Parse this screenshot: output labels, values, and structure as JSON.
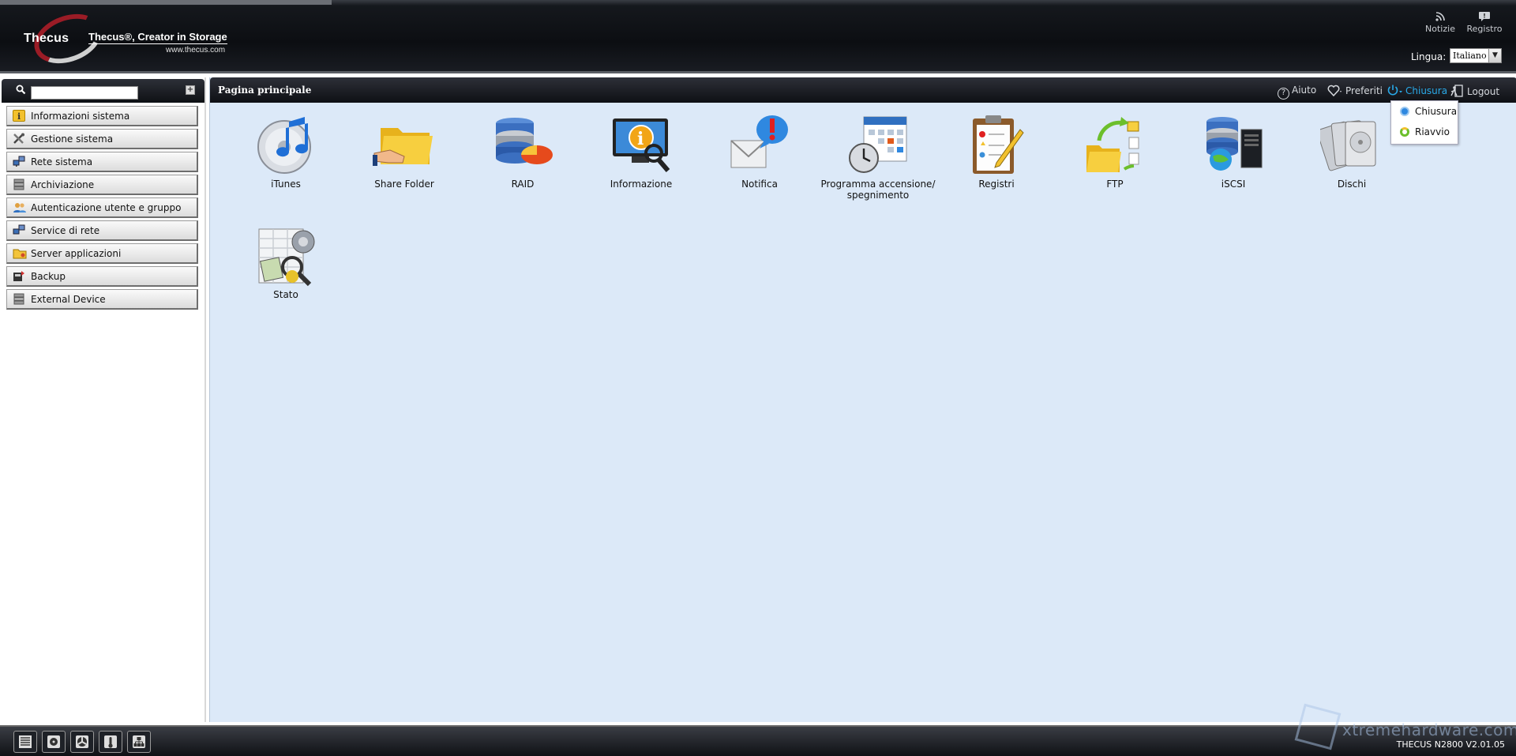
{
  "header": {
    "brand": "Thecus",
    "tagline": "Thecus®, Creator in Storage",
    "url": "www.thecus.com",
    "links": [
      {
        "label": "Notizie",
        "icon": "rss-icon"
      },
      {
        "label": "Registro",
        "icon": "chat-icon"
      }
    ],
    "language_label": "Lingua:",
    "language_value": "Italiano"
  },
  "sidebar": {
    "search_placeholder": "",
    "items": [
      {
        "label": "Informazioni sistema",
        "icon": "info-icon"
      },
      {
        "label": "Gestione sistema",
        "icon": "tools-icon"
      },
      {
        "label": "Rete sistema",
        "icon": "network-icon"
      },
      {
        "label": "Archiviazione",
        "icon": "storage-icon"
      },
      {
        "label": "Autenticazione utente e gruppo",
        "icon": "users-icon"
      },
      {
        "label": "Service di rete",
        "icon": "network-service-icon"
      },
      {
        "label": "Server applicazioni",
        "icon": "folder-app-icon"
      },
      {
        "label": "Backup",
        "icon": "backup-icon"
      },
      {
        "label": "External Device",
        "icon": "external-device-icon"
      }
    ]
  },
  "main": {
    "title": "Pagina principale",
    "toolbar": {
      "help": "Aiuto",
      "favorites": "Preferiti",
      "shutdown": "Chiusura",
      "logout": "Logout"
    },
    "dropdown": [
      {
        "label": "Chiusura",
        "icon": "power-icon"
      },
      {
        "label": "Riavvio",
        "icon": "restart-icon"
      }
    ],
    "apps": [
      {
        "label": "iTunes",
        "icon": "itunes-icon"
      },
      {
        "label": "Share Folder",
        "icon": "share-folder-icon"
      },
      {
        "label": "RAID",
        "icon": "raid-icon"
      },
      {
        "label": "Informazione",
        "icon": "information-icon"
      },
      {
        "label": "Notifica",
        "icon": "notification-icon"
      },
      {
        "label": "Programma accensione/ spegnimento",
        "icon": "schedule-icon"
      },
      {
        "label": "Registri",
        "icon": "logs-icon"
      },
      {
        "label": "FTP",
        "icon": "ftp-icon"
      },
      {
        "label": "iSCSI",
        "icon": "iscsi-icon"
      },
      {
        "label": "Dischi",
        "icon": "disks-icon"
      },
      {
        "label": "Stato",
        "icon": "status-icon"
      }
    ]
  },
  "footer": {
    "buttons": [
      "disk-status-icon",
      "hdd-icon",
      "fan-icon",
      "thermometer-icon",
      "network-tree-icon"
    ],
    "version": "THECUS N2800 V2.01.05",
    "watermark": "xtremehardware.com"
  },
  "colors": {
    "accent": "#29a9e8",
    "content_bg": "#dce9f8",
    "header_bg": "#0c0e12"
  }
}
